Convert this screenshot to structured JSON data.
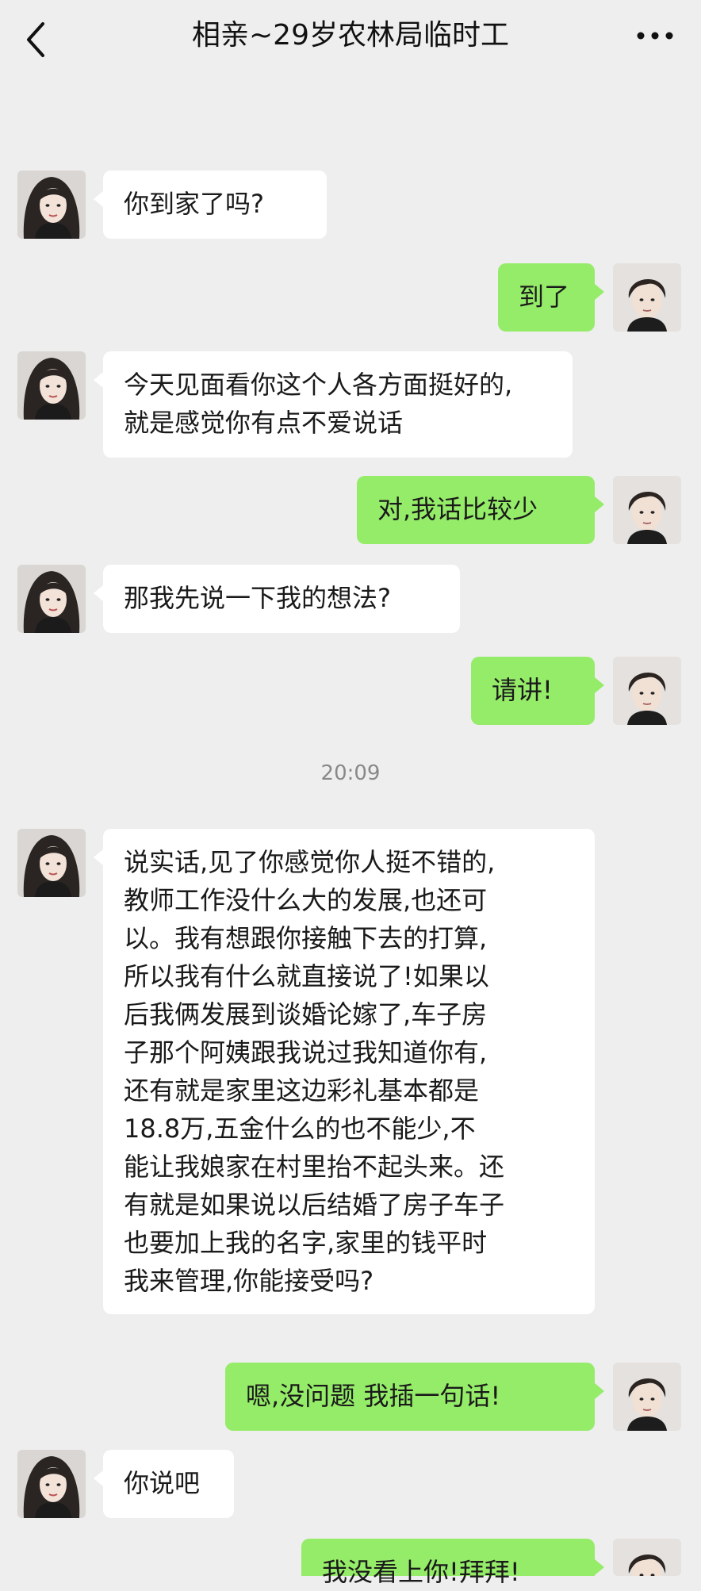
{
  "header": {
    "title": "相亲~29岁农林局临时工",
    "back_icon": "chevron-left-icon",
    "more_icon": "more-dots-icon"
  },
  "colors": {
    "background": "#eeeeee",
    "incoming_bubble": "#ffffff",
    "outgoing_bubble": "#95ec69"
  },
  "messages": [
    {
      "side": "in",
      "text": "你到家了吗?"
    },
    {
      "side": "out",
      "text": "到了"
    },
    {
      "side": "in",
      "lines": [
        "今天见面看你这个人各方面挺好的,",
        "就是感觉你有点不爱说话"
      ]
    },
    {
      "side": "out",
      "text": "对,我话比较少"
    },
    {
      "side": "in",
      "text": "那我先说一下我的想法?"
    },
    {
      "side": "out",
      "text": "请讲!"
    },
    {
      "side": "in",
      "lines": [
        "说实话,见了你感觉你人挺不错的,",
        "教师工作没什么大的发展,也还可",
        "以。我有想跟你接触下去的打算,",
        "所以我有什么就直接说了!如果以",
        "后我俩发展到谈婚论嫁了,车子房",
        "子那个阿姨跟我说过我知道你有,",
        "还有就是家里这边彩礼基本都是",
        "18.8万,五金什么的也不能少,不",
        "能让我娘家在村里抬不起头来。还",
        "有就是如果说以后结婚了房子车子",
        "也要加上我的名字,家里的钱平时",
        "我来管理,你能接受吗?"
      ]
    },
    {
      "side": "out",
      "text": "嗯,没问题 我插一句话!"
    },
    {
      "side": "in",
      "text": "你说吧"
    },
    {
      "side": "out",
      "text": "我没看上你!拜拜!"
    }
  ],
  "timestamp": "20:09"
}
